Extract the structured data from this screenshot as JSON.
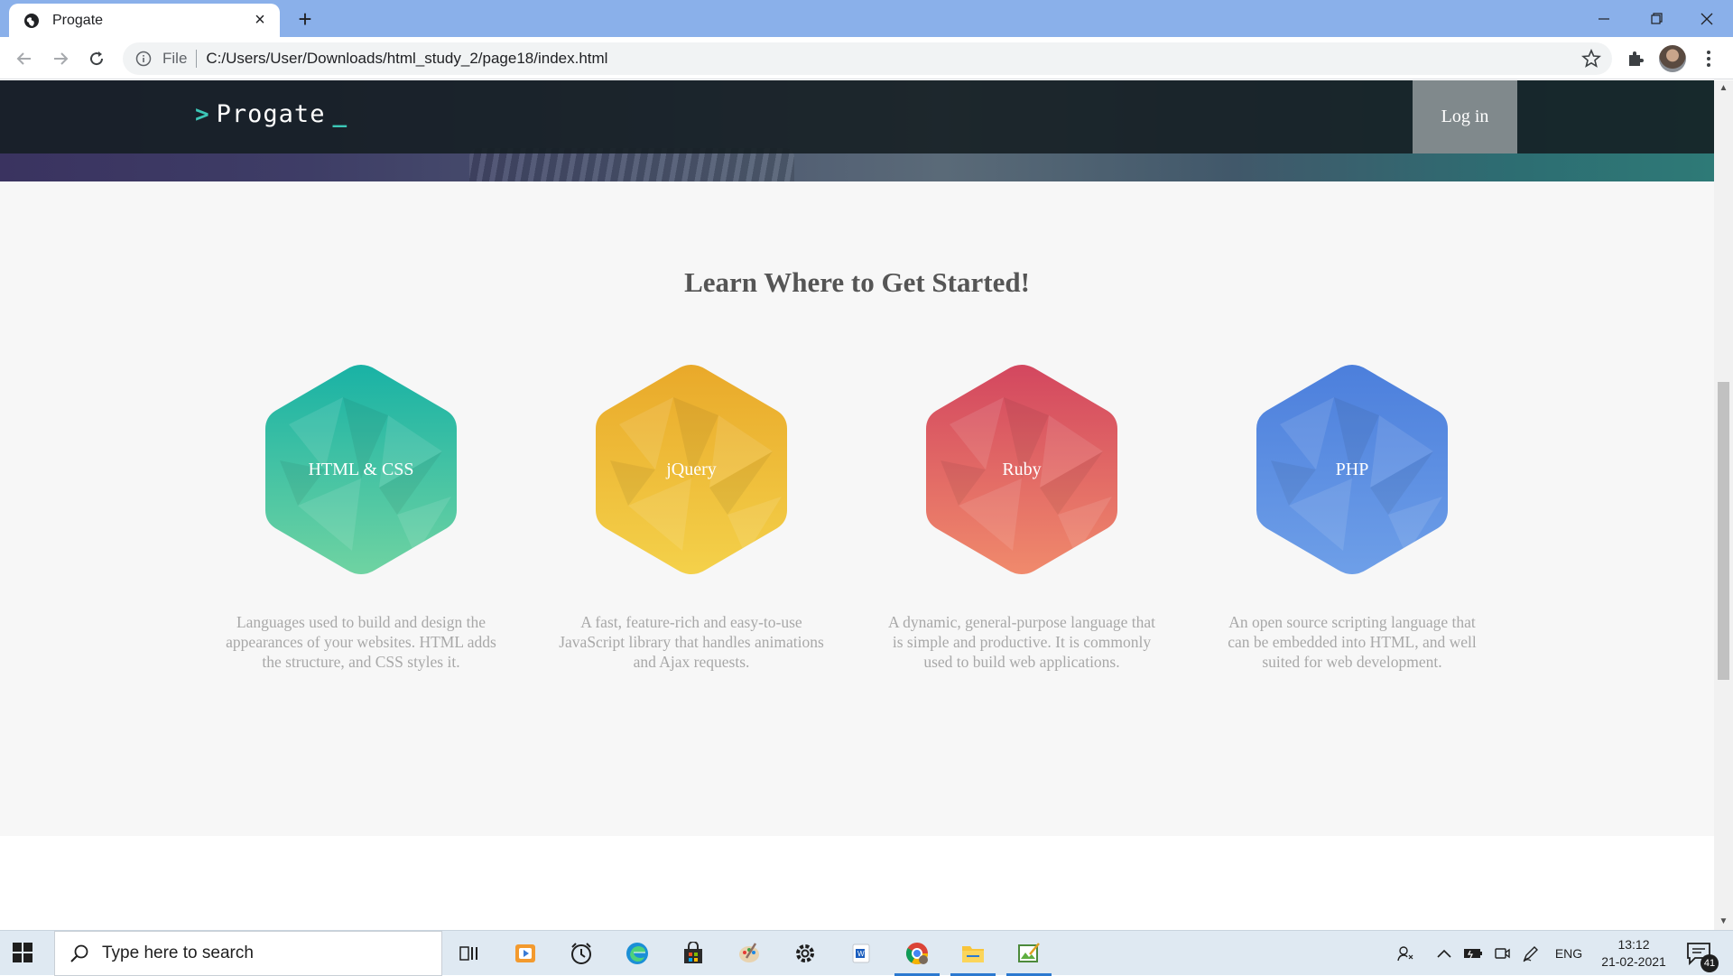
{
  "browser": {
    "tab_title": "Progate",
    "url_scheme_label": "File",
    "url": "C:/Users/User/Downloads/html_study_2/page18/index.html"
  },
  "page": {
    "header": {
      "logo_arrow": ">",
      "logo_text": "Progate",
      "logo_cursor": "_",
      "login_label": "Log in"
    },
    "lesson": {
      "title": "Learn Where to Get Started!",
      "items": [
        {
          "name": "HTML & CSS",
          "description": "Languages used to build and design the appearances of your websites. HTML adds the structure, and CSS styles it.",
          "colors": [
            "#19b2a5",
            "#6fd3a2"
          ]
        },
        {
          "name": "jQuery",
          "description": "A fast, feature-rich and easy-to-use JavaScript library that handles animations and Ajax requests.",
          "colors": [
            "#e9a92a",
            "#f4d14a"
          ]
        },
        {
          "name": "Ruby",
          "description": "A dynamic, general-purpose language that is simple and productive. It is commonly used to build web applications.",
          "colors": [
            "#d3475f",
            "#f08a6c"
          ]
        },
        {
          "name": "PHP",
          "description": "An open source scripting language that can be embedded into HTML, and well suited for web development.",
          "colors": [
            "#4c7fdc",
            "#6e9fe8"
          ]
        }
      ]
    }
  },
  "taskbar": {
    "search_placeholder": "Type here to search",
    "language": "ENG",
    "time": "13:12",
    "date": "21-02-2021",
    "notification_count": "41"
  },
  "colors": {
    "tabbar": "#8ab0ea",
    "accent_teal": "#3cc7b7",
    "login_bg": "#80898c",
    "lesson_bg": "#f7f7f7"
  }
}
